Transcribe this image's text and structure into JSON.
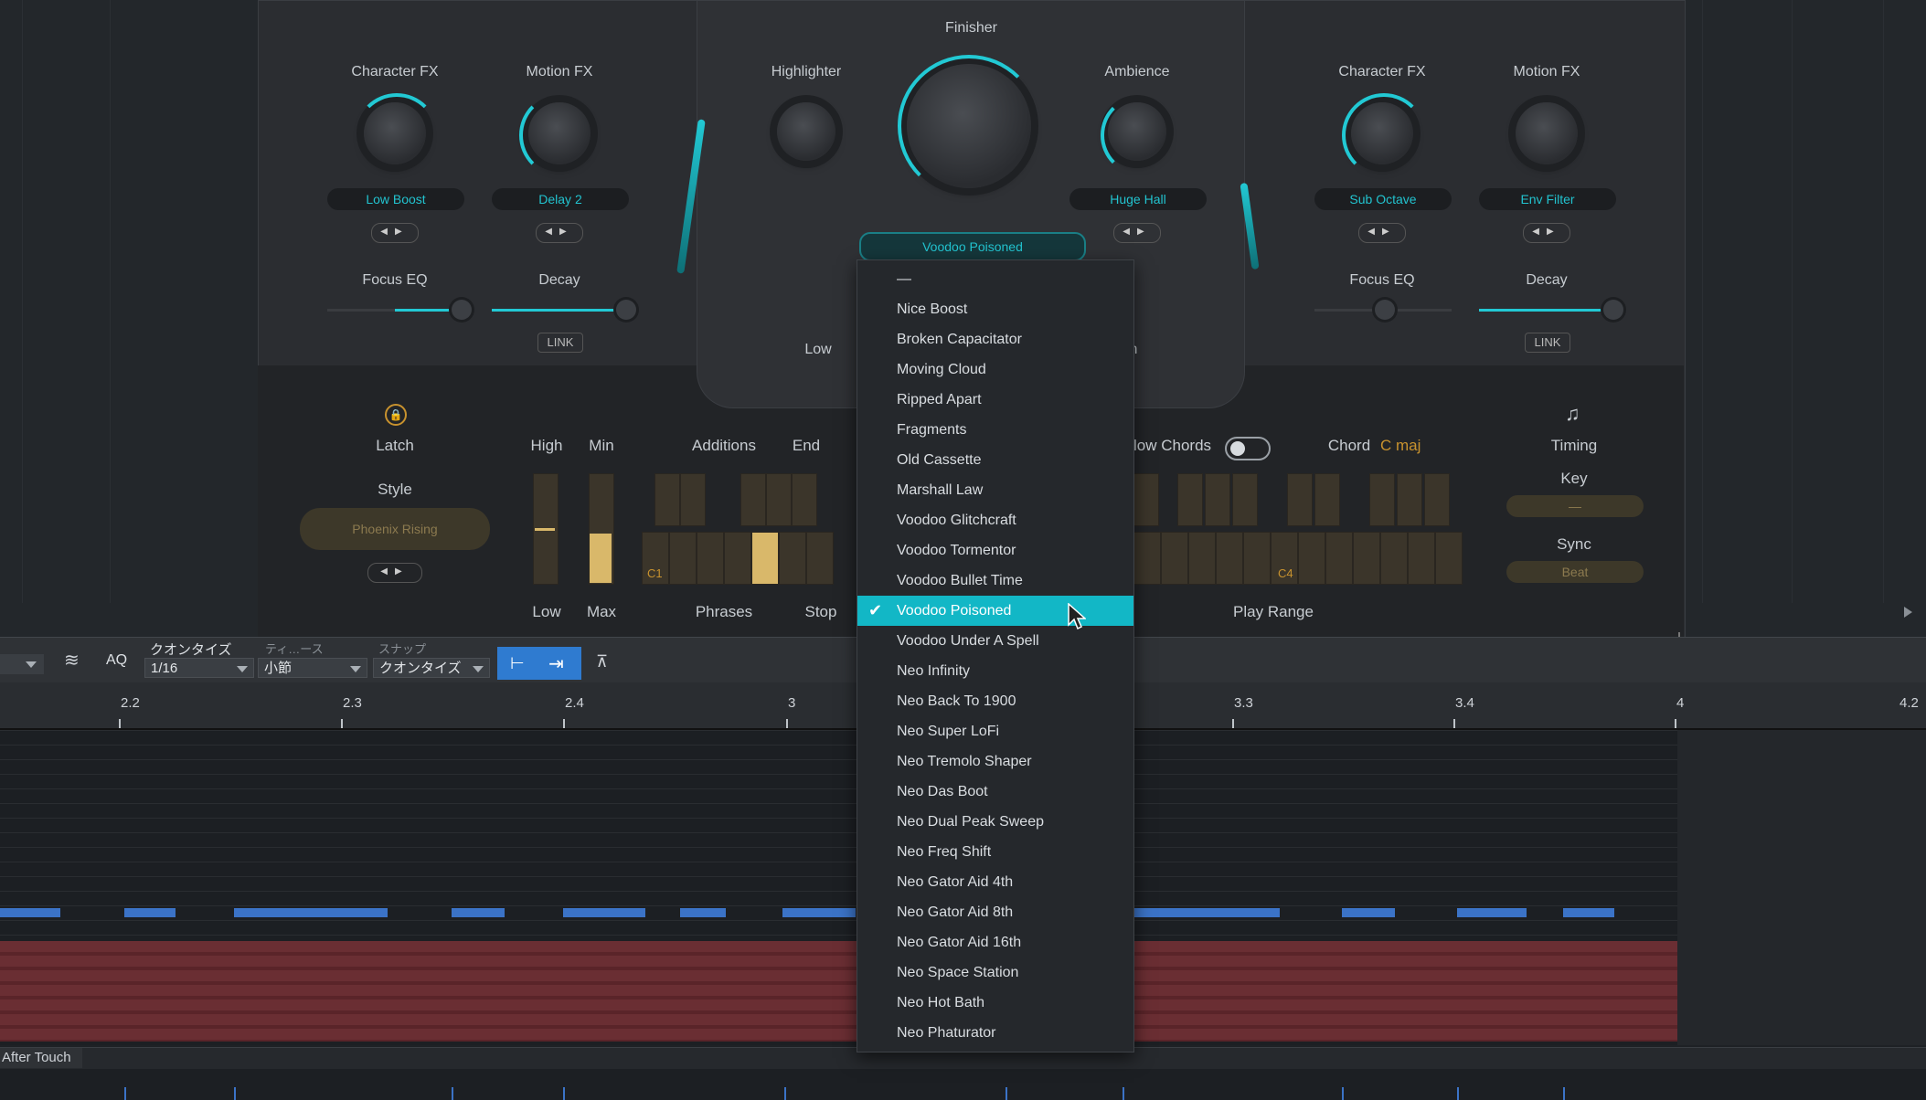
{
  "plugin": {
    "finisher_label": "Finisher",
    "finisher_preset": "Voodoo Poisoned",
    "left": {
      "character_fx_label": "Character FX",
      "character_fx_preset": "Low Boost",
      "motion_fx_label": "Motion FX",
      "motion_fx_preset": "Delay 2",
      "focus_eq_label": "Focus EQ",
      "decay_label": "Decay",
      "link_label": "LINK"
    },
    "right": {
      "character_fx_label": "Character FX",
      "character_fx_preset": "Sub Octave",
      "motion_fx_label": "Motion FX",
      "motion_fx_preset": "Env Filter",
      "focus_eq_label": "Focus EQ",
      "decay_label": "Decay",
      "link_label": "LINK"
    },
    "highlighter_label": "Highlighter",
    "ambience_label": "Ambience",
    "ambience_preset": "Huge Hall",
    "low_label": "Low",
    "high_partial_label": "h",
    "arp": {
      "latch_label": "Latch",
      "style_label": "Style",
      "style_value": "Phoenix Rising",
      "high_label": "High",
      "min_label": "Min",
      "low_label": "Low",
      "max_label": "Max",
      "additions_label": "Additions",
      "end_label": "End",
      "phrases_label": "Phrases",
      "stop_label": "Stop",
      "c1_label": "C1",
      "c4_label": "C4",
      "allow_chords_partial": "low Chords",
      "chord_label": "Chord",
      "chord_value": "C maj",
      "play_range_label": "Play Range",
      "timing_label": "Timing",
      "key_label": "Key",
      "key_value": "—",
      "sync_label": "Sync",
      "sync_value": "Beat"
    }
  },
  "toolbar": {
    "aq_label": "AQ",
    "quantize_label": "クオンタイズ",
    "quantize_value": "1/16",
    "length_partial_label": "ティ…ース",
    "length_value": "小節",
    "snap_partial_label": "スナップ",
    "snap_value": "クオンタイズ"
  },
  "ruler": {
    "marks": [
      "2.2",
      "2.3",
      "2.4",
      "3",
      "3.3",
      "3.4",
      "4",
      "4.2"
    ]
  },
  "after_touch_label": "After Touch",
  "dropdown": {
    "items": [
      "—",
      "Nice Boost",
      "Broken Capacitator",
      "Moving Cloud",
      "Ripped Apart",
      "Fragments",
      "Old Cassette",
      "Marshall Law",
      "Voodoo Glitchcraft",
      "Voodoo Tormentor",
      "Voodoo Bullet Time",
      "Voodoo Poisoned",
      "Voodoo Under A Spell",
      "Neo Infinity",
      "Neo Back To 1900",
      "Neo Super LoFi",
      "Neo Tremolo Shaper",
      "Neo Das Boot",
      "Neo Dual Peak Sweep",
      "Neo Freq Shift",
      "Neo Gator Aid 4th",
      "Neo Gator Aid 8th",
      "Neo Gator Aid 16th",
      "Neo Space Station",
      "Neo Hot Bath",
      "Neo Phaturator"
    ],
    "selected": "Voodoo Poisoned",
    "check_icon": "✔"
  },
  "colors": {
    "accent_cyan": "#12b7c6",
    "gold": "#d9b86a",
    "note_blue": "#3b73c7"
  }
}
